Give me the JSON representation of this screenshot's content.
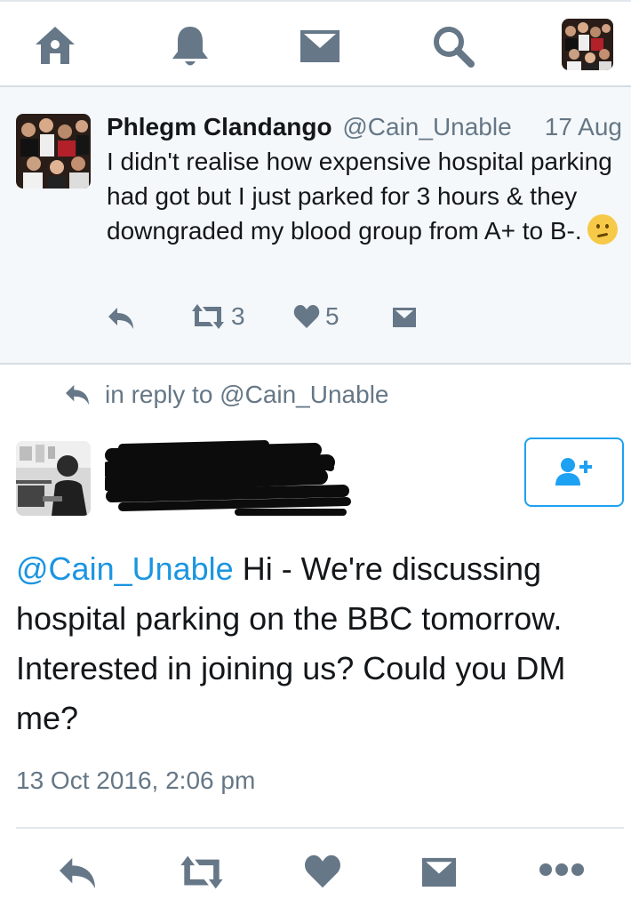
{
  "nav": {
    "items": [
      {
        "name": "home",
        "icon": "home-icon"
      },
      {
        "name": "notifications",
        "icon": "bell-icon"
      },
      {
        "name": "messages",
        "icon": "envelope-icon"
      },
      {
        "name": "search",
        "icon": "search-icon"
      },
      {
        "name": "profile",
        "icon": "avatar"
      }
    ]
  },
  "original_tweet": {
    "name": "Phlegm Clandango",
    "handle": "@Cain_Unable",
    "date": "17 Aug",
    "text": "I didn't realise how expensive hospital parking had got but I just parked for 3 hours & they downgraded my blood group from A+ to B-.",
    "emoji": "confused-face-emoji",
    "retweets": "3",
    "likes": "5"
  },
  "reply": {
    "context_label": "in reply to @Cain_Unable",
    "mention": "@Cain_Unable",
    "text": " Hi - We're discussing hospital parking on the BBC tomorrow. Interested in joining us? Could you DM me?",
    "timestamp": "13 Oct 2016, 2:06 pm",
    "follow_icon": "add-user-icon"
  },
  "colors": {
    "accent": "#1da1f2",
    "mention": "#1b95e0",
    "icon": "#667787",
    "muted_text": "#657786",
    "tweet_bg": "#f5f8fa"
  }
}
